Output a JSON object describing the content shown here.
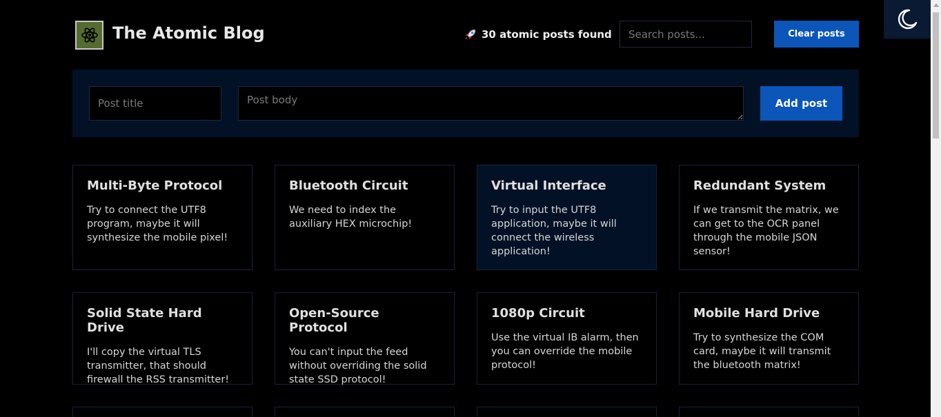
{
  "header": {
    "title": "The Atomic Blog",
    "post_count_text": "30 atomic posts found",
    "search_placeholder": "Search posts...",
    "clear_label": "Clear posts",
    "logo_icon": "atom-icon",
    "count_icon": "rocket-icon",
    "theme_icon": "moon-icon"
  },
  "form": {
    "title_placeholder": "Post title",
    "body_placeholder": "Post body",
    "add_label": "Add post"
  },
  "colors": {
    "background": "#000000",
    "panel": "#021126",
    "accent": "#0b56b8",
    "logo_bg": "#556b2f"
  },
  "posts": [
    {
      "title": "Multi-Byte Protocol",
      "body": "Try to connect the UTF8 program, maybe it will synthesize the mobile pixel!"
    },
    {
      "title": "Bluetooth Circuit",
      "body": "We need to index the auxiliary HEX microchip!"
    },
    {
      "title": "Virtual Interface",
      "body": "Try to input the UTF8 application, maybe it will connect the wireless application!"
    },
    {
      "title": "Redundant System",
      "body": "If we transmit the matrix, we can get to the OCR panel through the mobile JSON sensor!"
    },
    {
      "title": "Solid State Hard Drive",
      "body": "I'll copy the virtual TLS transmitter, that should firewall the RSS transmitter!"
    },
    {
      "title": "Open-Source Protocol",
      "body": "You can't input the feed without overriding the solid state SSD protocol!"
    },
    {
      "title": "1080p Circuit",
      "body": "Use the virtual IB alarm, then you can override the mobile protocol!"
    },
    {
      "title": "Mobile Hard Drive",
      "body": "Try to synthesize the COM card, maybe it will transmit the bluetooth matrix!"
    },
    {
      "title": "",
      "body": ""
    },
    {
      "title": "",
      "body": ""
    },
    {
      "title": "",
      "body": ""
    },
    {
      "title": "",
      "body": ""
    }
  ]
}
